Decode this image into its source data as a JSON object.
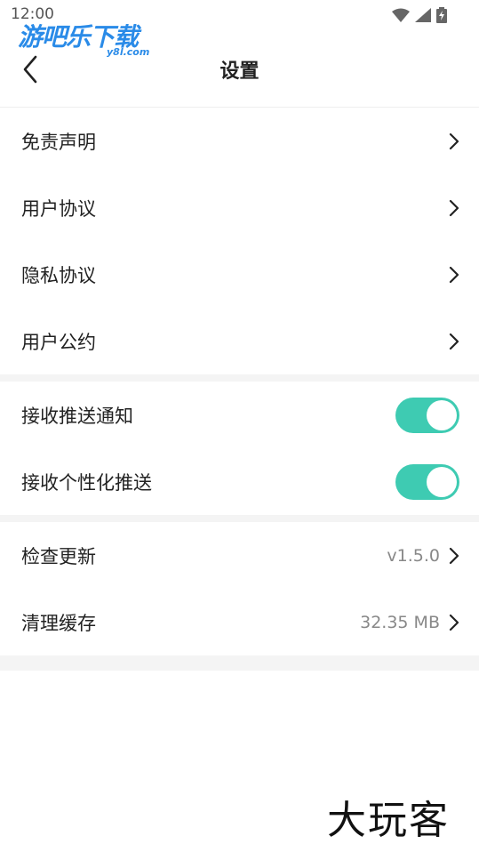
{
  "status_bar": {
    "time": "12:00"
  },
  "watermark": {
    "text": "游吧乐下载",
    "sub": "y8l.com"
  },
  "header": {
    "title": "设置"
  },
  "groups": [
    {
      "items": [
        {
          "label": "免责声明"
        },
        {
          "label": "用户协议"
        },
        {
          "label": "隐私协议"
        },
        {
          "label": "用户公约"
        }
      ]
    },
    {
      "items": [
        {
          "label": "接收推送通知",
          "enabled": true
        },
        {
          "label": "接收个性化推送",
          "enabled": true
        }
      ]
    },
    {
      "items": [
        {
          "label": "检查更新",
          "value": "v1.5.0"
        },
        {
          "label": "清理缓存",
          "value": "32.35 MB"
        }
      ]
    }
  ],
  "brand": {
    "text": "大玩客"
  },
  "colors": {
    "toggle_on": "#3ecbb2",
    "band": "#f4f4f4"
  }
}
